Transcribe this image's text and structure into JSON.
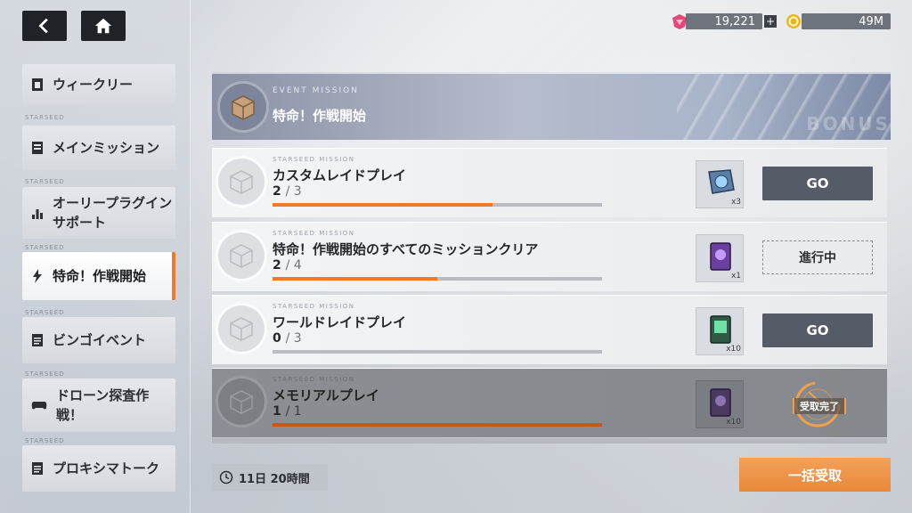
{
  "nav": {
    "back_icon": "chevron-left-icon",
    "home_icon": "home-icon"
  },
  "currency": {
    "gems": "19,221",
    "gold": "49M",
    "gem_color": "#e8457a",
    "gold_color": "#e6b820"
  },
  "sidebar": {
    "seed_label": "STARSEED",
    "items": [
      {
        "label": "ウィークリー",
        "icon": "calendar-icon"
      },
      {
        "label": "メインミッション",
        "icon": "list-icon"
      },
      {
        "label": "オーリープラグインサポート",
        "icon": "bar-chart-icon"
      },
      {
        "label": "特命！作戦開始",
        "icon": "bolt-icon",
        "active": true
      },
      {
        "label": "ビンゴイベント",
        "icon": "document-icon"
      },
      {
        "label": "ドローン探査作戦！",
        "icon": "gamepad-icon"
      },
      {
        "label": "プロキシマトーク",
        "icon": "document-icon"
      }
    ]
  },
  "event": {
    "subtitle": "EVENT MISSION",
    "title": "特命！作戦開始",
    "bg_text": "BONUS"
  },
  "missions": [
    {
      "sub": "STARSEED MISSION",
      "title": "カスタムレイドプレイ",
      "current": "2",
      "total": "/ 3",
      "progress": 0.667,
      "reward_qty": "x3",
      "reward_icon": "blue-crystal-icon",
      "action": "GO"
    },
    {
      "sub": "STARSEED MISSION",
      "title": "特命！作戦開始のすべてのミッションクリア",
      "current": "2",
      "total": "/ 4",
      "progress": 0.5,
      "reward_qty": "x1",
      "reward_icon": "purple-card-icon",
      "action": "進行中"
    },
    {
      "sub": "STARSEED MISSION",
      "title": "ワールドレイドプレイ",
      "current": "0",
      "total": "/ 3",
      "progress": 0.0,
      "reward_qty": "x10",
      "reward_icon": "green-card-icon",
      "action": "GO"
    },
    {
      "sub": "STARSEED MISSION",
      "title": "メモリアルプレイ",
      "current": "1",
      "total": "/ 1",
      "progress": 1.0,
      "reward_qty": "x10",
      "reward_icon": "purple-card-icon",
      "action": "受取完了"
    }
  ],
  "footer": {
    "timer": "11日 20時間",
    "claim_all": "一括受取"
  },
  "colors": {
    "accent": "#f07a2c",
    "go_button": "#565b68",
    "claim_all": "#e8883a"
  }
}
